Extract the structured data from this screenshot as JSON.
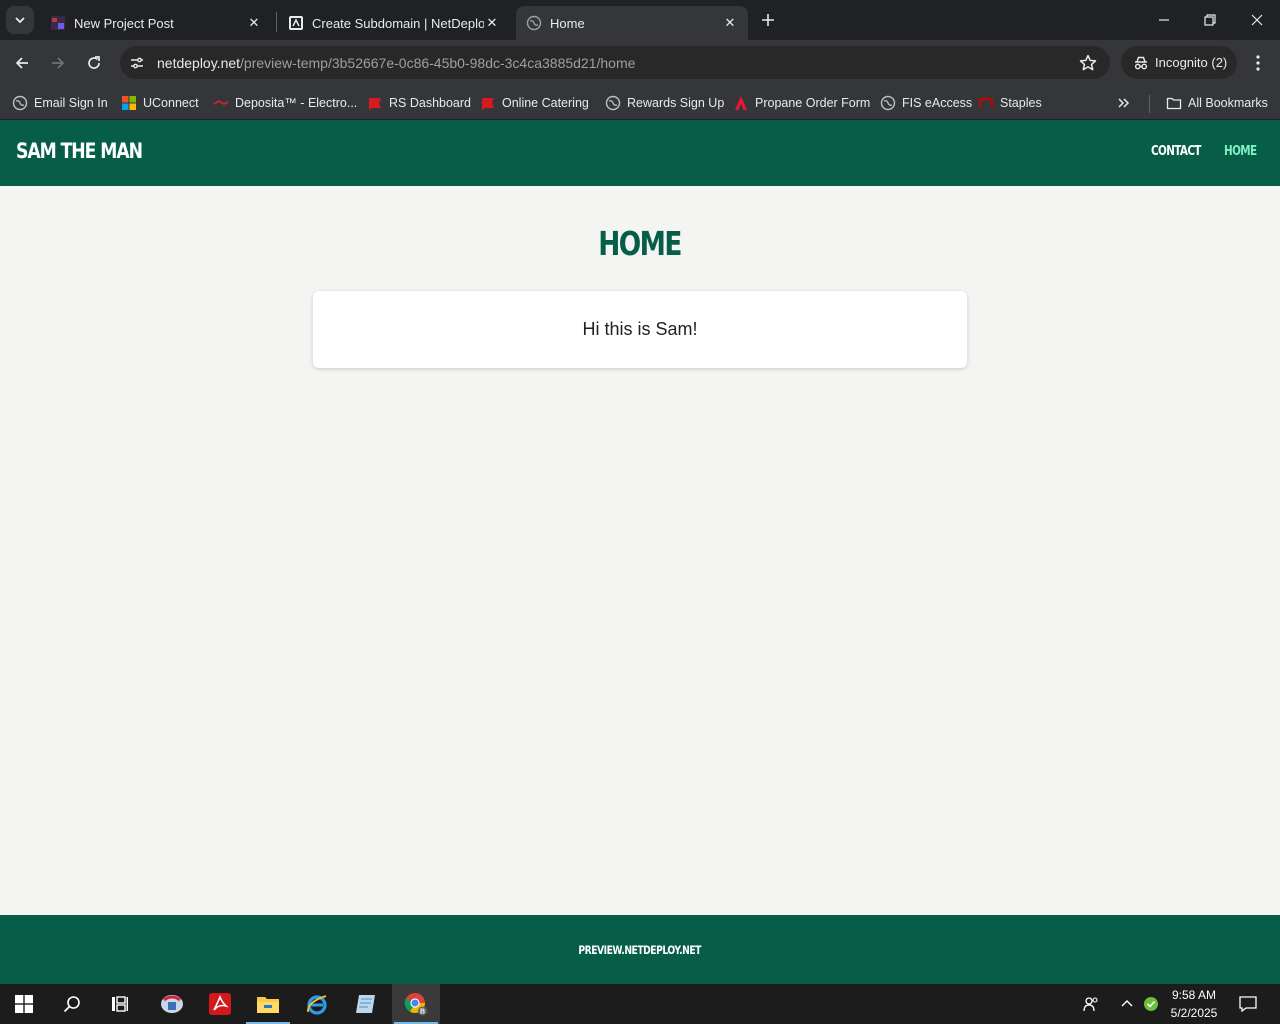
{
  "browser": {
    "tabs": [
      {
        "title": "New Project Post"
      },
      {
        "title": "Create Subdomain | NetDeploy"
      },
      {
        "title": "Home"
      }
    ],
    "url_host": "netdeploy.net",
    "url_path": "/preview-temp/3b52667e-0c86-45b0-98dc-3c4ca3885d21/home",
    "incognito_label": "Incognito (2)",
    "bookmarks": [
      {
        "label": "Email Sign In",
        "icon": "globe-icon"
      },
      {
        "label": "UConnect",
        "icon": "windows-logo-icon"
      },
      {
        "label": "Deposita™ - Electro...",
        "icon": "deposita-logo-icon"
      },
      {
        "label": "RS Dashboard",
        "icon": "red-flag-icon"
      },
      {
        "label": "Online Catering",
        "icon": "red-flag-icon"
      },
      {
        "label": "Rewards Sign Up",
        "icon": "globe-icon"
      },
      {
        "label": "Propane Order Form",
        "icon": "red-a-logo-icon"
      },
      {
        "label": "FIS eAccess",
        "icon": "globe-icon"
      },
      {
        "label": "Staples",
        "icon": "staples-logo-icon"
      }
    ],
    "all_bookmarks_label": "All Bookmarks"
  },
  "site": {
    "brand": "SAM THE MAN",
    "nav": {
      "contact": "CONTACT",
      "home": "HOME"
    },
    "page_title": "HOME",
    "card_text": "Hi this is Sam!",
    "footer_text": "PREVIEW.NETDEPLOY.NET"
  },
  "taskbar": {
    "time": "9:58 AM",
    "date": "5/2/2025"
  },
  "colors": {
    "site_green": "#075e48",
    "nav_active": "#7ef0c3",
    "page_bg": "#f4f4f2"
  }
}
